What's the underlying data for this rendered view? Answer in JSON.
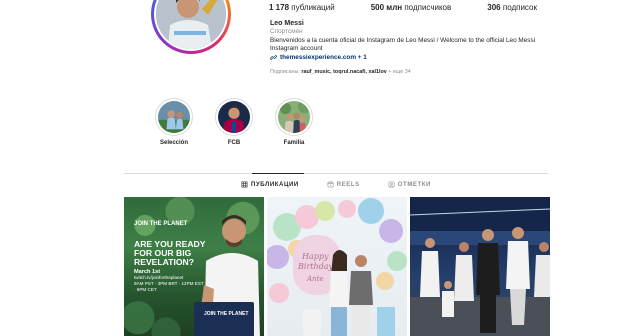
{
  "profile": {
    "stats": {
      "posts": {
        "count": "1 178",
        "label": "публикаций"
      },
      "followers": {
        "count": "500 млн",
        "label": "подписчиков"
      },
      "following": {
        "count": "306",
        "label": "подписок"
      }
    },
    "name": "Leo Messi",
    "category": "Спортсмен",
    "bio_line1": "Bienvenidos a la cuenta oficial de Instagram de Leo Messi / Welcome to the official Leo Messi",
    "bio_line2": "Instagram account",
    "link": "themessiexperience.com + 1",
    "followed_by": {
      "prefix": "Подписаны: ",
      "users": "rauf_music, toqrul.nacafi, xal1lov",
      "suffix": " + еще 34"
    }
  },
  "highlights": [
    {
      "label": "Selección"
    },
    {
      "label": "FCB"
    },
    {
      "label": "Familia"
    }
  ],
  "tabs": [
    {
      "label": "ПУБЛИКАЦИИ",
      "icon": "grid-icon",
      "active": true
    },
    {
      "label": "REELS",
      "icon": "reels-icon",
      "active": false
    },
    {
      "label": "ОТМЕТКИ",
      "icon": "tagged-icon",
      "active": false
    }
  ],
  "posts": {
    "p1": {
      "brand": "JOIN THE PLANET",
      "headline": "ARE YOU READY FOR OUR BIG REVELATION?",
      "date": "March 1st",
      "site": "twitch.tv/joinfortheplanet",
      "times": "9AM PST · 3PM BRT · 12PM EST · 6PM CET",
      "box_brand": "JOIN THE PLANET"
    },
    "p2": {
      "banner_line1": "Happy",
      "banner_line2": "Birthday",
      "banner_name": "Ante"
    }
  },
  "colors": {
    "link": "#00376b",
    "muted": "#8e8e8e",
    "text": "#262626",
    "divider": "#dbdbdb"
  }
}
